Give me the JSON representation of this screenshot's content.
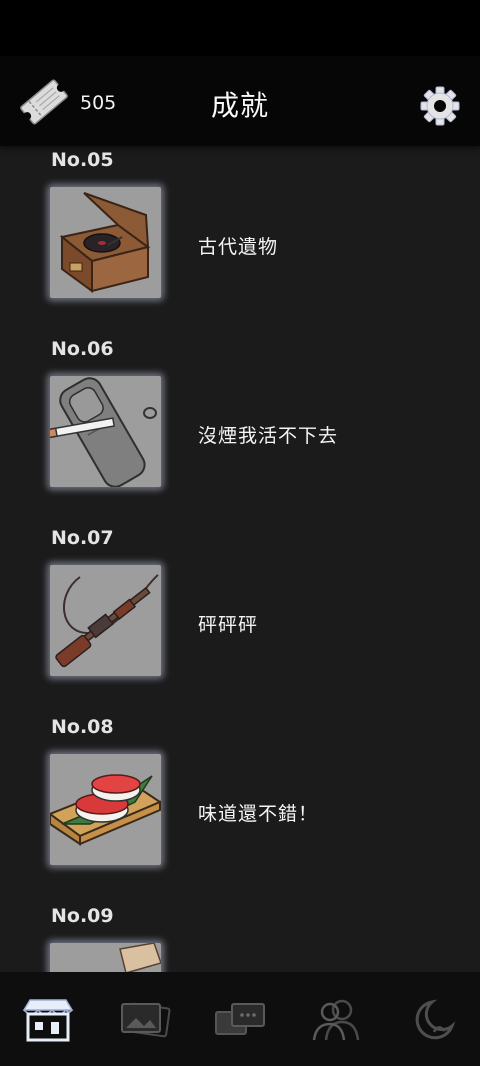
{
  "header": {
    "ticket_count": "505",
    "title": "成就"
  },
  "achievements": [
    {
      "no": "No.05",
      "title": "古代遺物",
      "icon": "phonograph-icon"
    },
    {
      "no": "No.06",
      "title": "沒煙我活不下去",
      "icon": "cigarette-icon"
    },
    {
      "no": "No.07",
      "title": "砰砰砰",
      "icon": "rifle-icon"
    },
    {
      "no": "No.08",
      "title": "味道還不錯！",
      "icon": "sushi-icon"
    },
    {
      "no": "No.09",
      "title": "",
      "icon": "scroll-icon"
    }
  ],
  "tabbar": {
    "tabs": [
      {
        "name": "shop-tab",
        "icon": "shop-icon",
        "active": true
      },
      {
        "name": "gallery-tab",
        "icon": "gallery-icon",
        "active": false
      },
      {
        "name": "chat-tab",
        "icon": "chat-icon",
        "active": false
      },
      {
        "name": "characters-tab",
        "icon": "people-icon",
        "active": false
      },
      {
        "name": "night-tab",
        "icon": "moon-icon",
        "active": false
      }
    ]
  },
  "colors": {
    "background": "#1b1b1b",
    "header": "#060606",
    "thumb_bg": "#9d9d9d",
    "thumb_glow": "#d7e1ff"
  }
}
